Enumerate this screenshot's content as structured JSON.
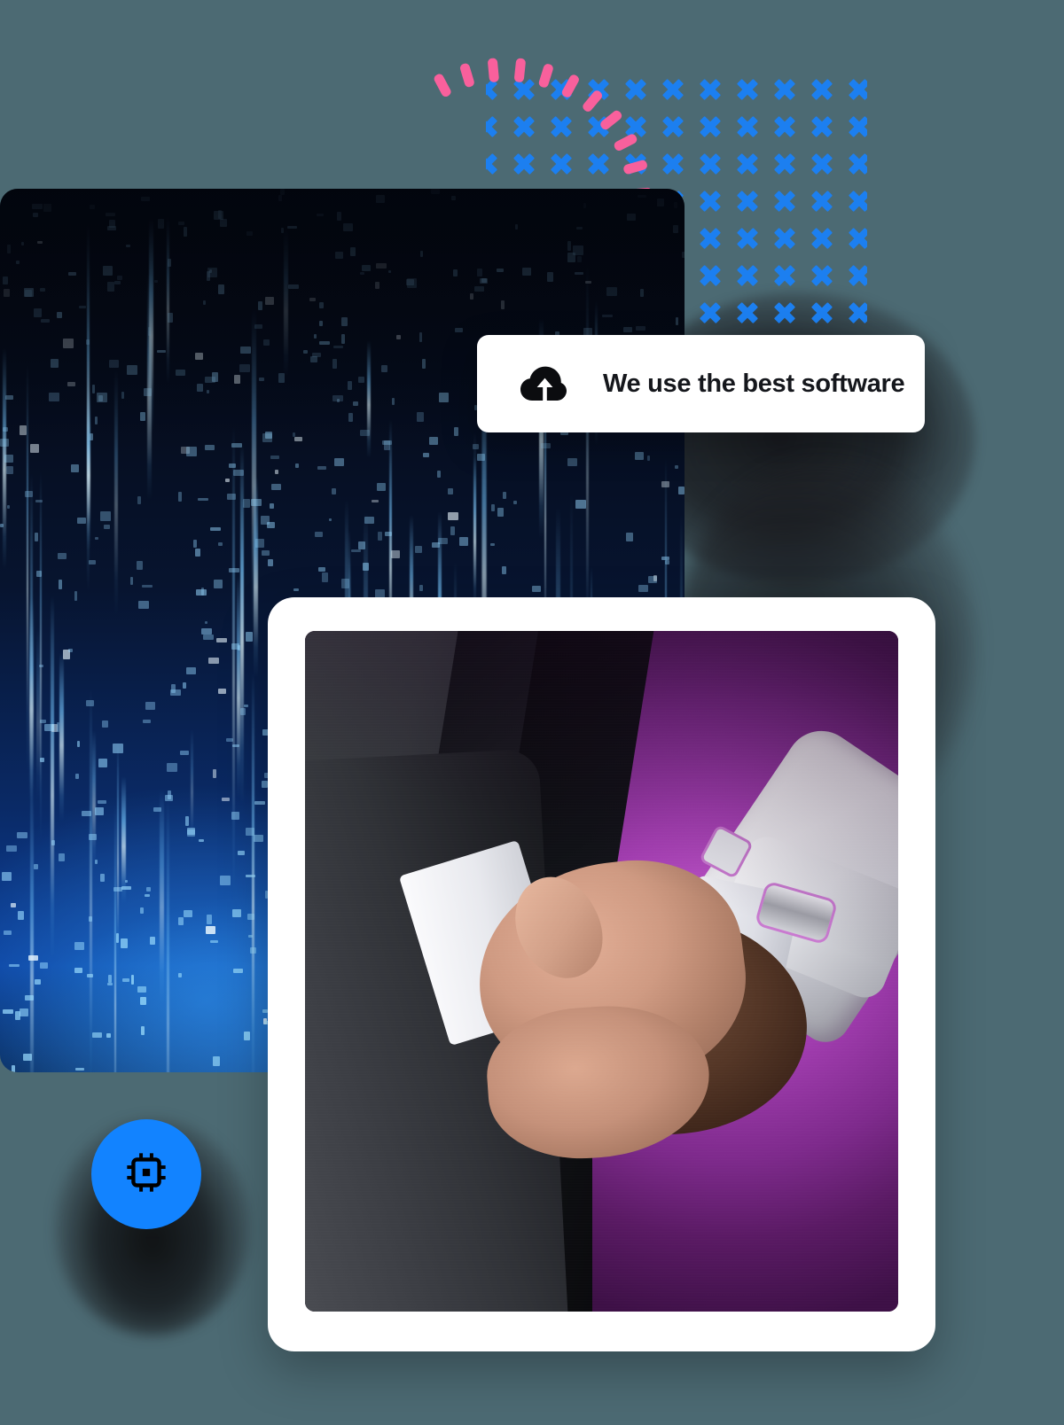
{
  "page": {
    "background_color": "#4c6a73",
    "title": "AI technology hero collage"
  },
  "decor": {
    "x_pattern": {
      "icon": "x-mark-icon",
      "color": "#1c7ff0",
      "columns": 11,
      "rows": 8,
      "spacing_px": 42
    },
    "arc": {
      "icon": "dashed-arc-decoration",
      "color": "#f9609c",
      "dash_count": 13,
      "start_angle_deg": -118,
      "end_angle_deg": 18
    }
  },
  "matrix_panel": {
    "name": "digital-rain-image",
    "alt": "Blue digital matrix code rain",
    "colors": {
      "top": "#04070f",
      "bottom": "#0b3f9c",
      "glyph": "#8fd4ff"
    }
  },
  "card": {
    "icon": "cloud-upload-icon",
    "label": "We use the best software",
    "background_color": "#ffffff",
    "text_color": "#15171c"
  },
  "photo_frame": {
    "name": "handshake-photo",
    "alt": "Businessman in a dark suit shaking hands with a white robotic arm on a purple background",
    "frame_color": "#ffffff",
    "accent_color": "#c55ad0"
  },
  "cpu_button": {
    "icon": "cpu-chip-icon",
    "background_color": "#1283ff",
    "icon_color": "#000000",
    "label": ""
  }
}
